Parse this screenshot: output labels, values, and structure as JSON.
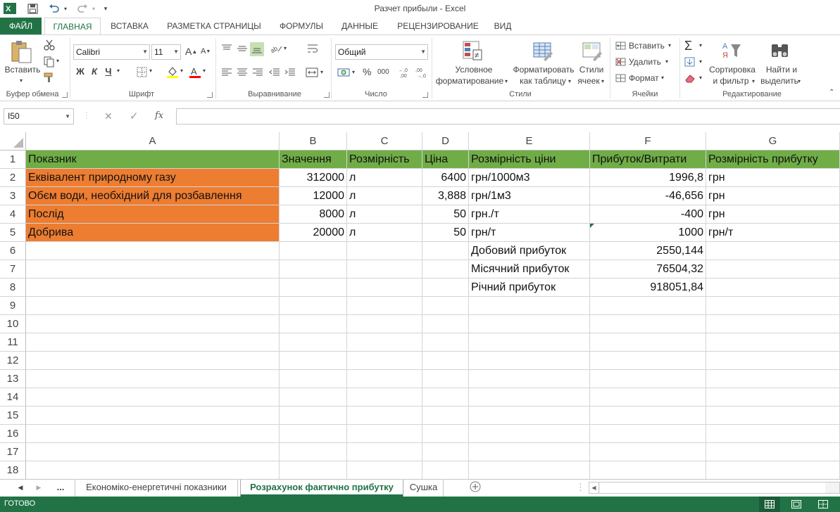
{
  "window": {
    "title": "Разчет прибыли - Excel"
  },
  "ribbon_tabs": [
    "ФАЙЛ",
    "ГЛАВНАЯ",
    "ВСТАВКА",
    "РАЗМЕТКА СТРАНИЦЫ",
    "ФОРМУЛЫ",
    "ДАННЫЕ",
    "РЕЦЕНЗИРОВАНИЕ",
    "ВИД"
  ],
  "ribbon": {
    "paste_label": "Вставить",
    "font_name": "Calibri",
    "font_size": "11",
    "bold": "Ж",
    "italic": "К",
    "underline": "Ч",
    "number_format": "Общий",
    "cond_format_1": "Условное",
    "cond_format_2": "форматирование",
    "format_table_1": "Форматировать",
    "format_table_2": "как таблицу",
    "cell_styles_1": "Стили",
    "cell_styles_2": "ячеек",
    "insert": "Вставить",
    "delete": "Удалить",
    "format": "Формат",
    "sort_1": "Сортировка",
    "sort_2": "и фильтр",
    "find_1": "Найти и",
    "find_2": "выделить",
    "groups": {
      "clipboard": "Буфер обмена",
      "font": "Шрифт",
      "alignment": "Выравнивание",
      "number": "Число",
      "styles": "Стили",
      "cells": "Ячейки",
      "editing": "Редактирование"
    }
  },
  "formula_bar": {
    "name_box": "I50",
    "fx": "fx",
    "formula": ""
  },
  "columns": [
    "A",
    "B",
    "C",
    "D",
    "E",
    "F",
    "G"
  ],
  "rows": [
    "1",
    "2",
    "3",
    "4",
    "5",
    "6",
    "7",
    "8",
    "9",
    "10",
    "11",
    "12",
    "13",
    "14",
    "15",
    "16",
    "17",
    "18"
  ],
  "cells": {
    "A1": "Показник",
    "B1": "Значення",
    "C1": "Розмірність",
    "D1": "Ціна",
    "E1": "Розмірність ціни",
    "F1": "Прибуток/Витрати",
    "G1": "Розмірність прибутку",
    "A2": "Еквівалент природному газу",
    "B2": "312000",
    "C2": "л",
    "D2": "6400",
    "E2": "грн/1000м3",
    "F2": "1996,8",
    "G2": "грн",
    "A3": "Обєм води, необхідний для розбавлення",
    "B3": "12000",
    "C3": "л",
    "D3": "3,888",
    "E3": "грн/1м3",
    "F3": "-46,656",
    "G3": "грн",
    "A4": "Послід",
    "B4": "8000",
    "C4": "л",
    "D4": "50",
    "E4": "грн./т",
    "F4": "-400",
    "G4": "грн",
    "A5": "Добрива",
    "B5": "20000",
    "C5": "л",
    "D5": "50",
    "E5": "грн/т",
    "F5": "1000",
    "G5": "грн/т",
    "E6": "Добовий прибуток",
    "F6": "2550,144",
    "E7": "Місячний прибуток",
    "F7": "76504,32",
    "E8": "Річний прибуток",
    "F8": "918051,84"
  },
  "sheet_tabs": [
    "...",
    "Економіко-енергетичні показники",
    "Розрахунок фактично прибутку",
    "Сушка"
  ],
  "active_sheet": "Розрахунок фактично прибутку",
  "status": {
    "text": "ГОТОВО"
  },
  "colors": {
    "excel_green": "#217346",
    "header_fill": "#70ad47",
    "label_fill": "#ed7d31"
  }
}
